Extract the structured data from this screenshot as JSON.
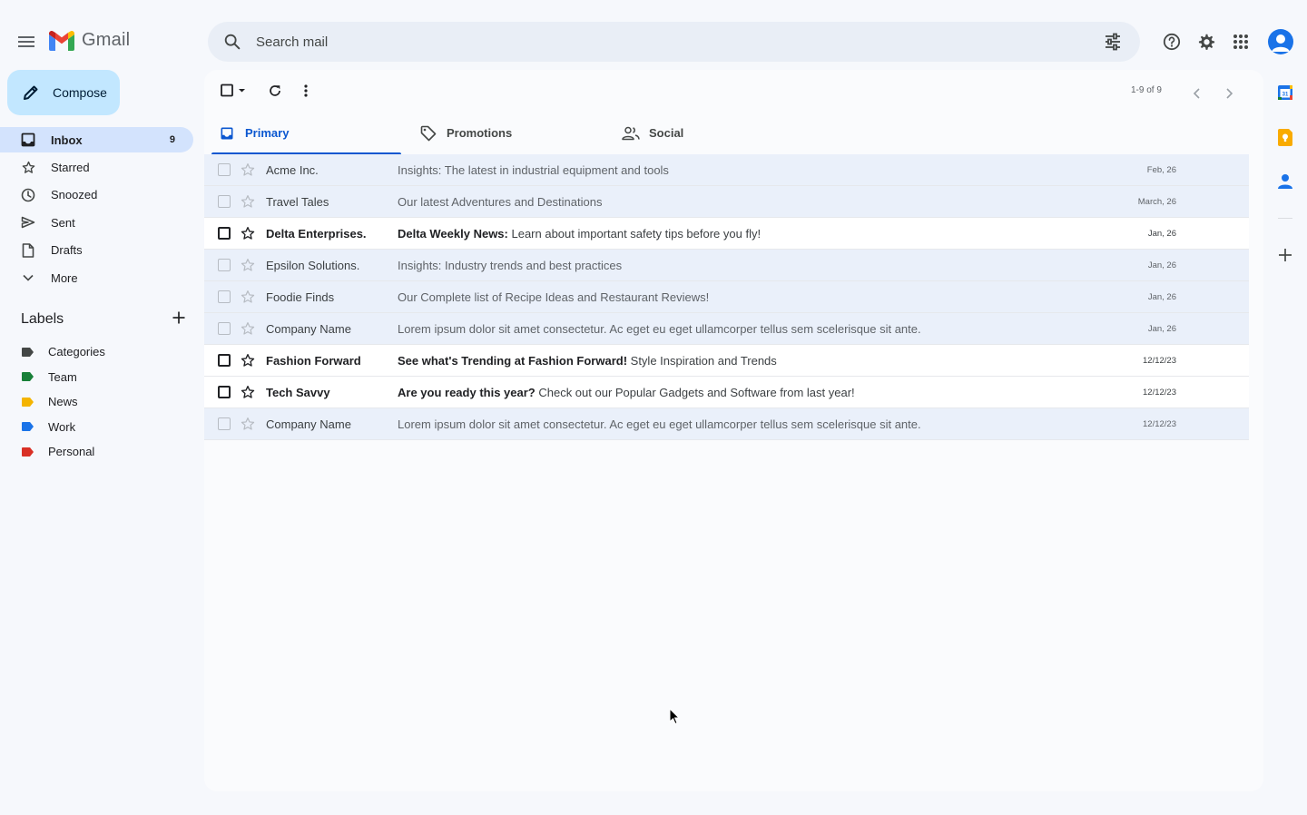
{
  "app": {
    "name": "Gmail"
  },
  "search": {
    "placeholder": "Search mail"
  },
  "compose": {
    "label": "Compose"
  },
  "nav": {
    "items": [
      {
        "label": "Inbox",
        "icon": "inbox-icon",
        "count": "9"
      },
      {
        "label": "Starred",
        "icon": "star-icon"
      },
      {
        "label": "Snoozed",
        "icon": "clock-icon"
      },
      {
        "label": "Sent",
        "icon": "send-icon"
      },
      {
        "label": "Drafts",
        "icon": "draft-icon"
      },
      {
        "label": "More",
        "icon": "chevron-down-icon"
      }
    ]
  },
  "labels": {
    "title": "Labels",
    "items": [
      {
        "label": "Categories",
        "color": "#444746"
      },
      {
        "label": "Team",
        "color": "#188038"
      },
      {
        "label": "News",
        "color": "#f4b400"
      },
      {
        "label": "Work",
        "color": "#1a73e8"
      },
      {
        "label": "Personal",
        "color": "#d93025"
      }
    ]
  },
  "toolbar": {
    "pager": "1-9 of 9"
  },
  "tabs": [
    {
      "label": "Primary",
      "icon": "inbox-icon"
    },
    {
      "label": "Promotions",
      "icon": "tag-icon"
    },
    {
      "label": "Social",
      "icon": "people-icon"
    }
  ],
  "emails": [
    {
      "sender": "Acme Inc.",
      "subject": "",
      "snippet": "Insights: The latest in industrial equipment and tools",
      "date": "Feb, 26",
      "unread": false
    },
    {
      "sender": "Travel Tales",
      "subject": "",
      "snippet": "Our latest Adventures and Destinations",
      "date": "March, 26",
      "unread": false
    },
    {
      "sender": "Delta Enterprises.",
      "subject": "Delta Weekly News:",
      "snippet": " Learn about important safety tips before you fly!",
      "date": "Jan, 26",
      "unread": true
    },
    {
      "sender": "Epsilon Solutions.",
      "subject": "",
      "snippet": "Insights: Industry trends and best practices",
      "date": "Jan, 26",
      "unread": false
    },
    {
      "sender": "Foodie Finds",
      "subject": "",
      "snippet": "Our Complete list of Recipe Ideas and Restaurant Reviews!",
      "date": "Jan, 26",
      "unread": false
    },
    {
      "sender": "Company Name",
      "subject": "",
      "snippet": "Lorem ipsum dolor sit amet consectetur. Ac eget eu eget ullamcorper tellus sem scelerisque sit ante.",
      "date": "Jan, 26",
      "unread": false
    },
    {
      "sender": "Fashion Forward",
      "subject": "See what's Trending at Fashion Forward!",
      "snippet": " Style Inspiration and Trends",
      "date": "12/12/23",
      "unread": true
    },
    {
      "sender": "Tech Savvy",
      "subject": "Are you ready this year?",
      "snippet": " Check out our Popular Gadgets and Software from last year!",
      "date": "12/12/23",
      "unread": true
    },
    {
      "sender": "Company Name",
      "subject": "",
      "snippet": "Lorem ipsum dolor sit amet consectetur. Ac eget eu eget ullamcorper tellus sem scelerisque sit ante.",
      "date": "12/12/23",
      "unread": false
    }
  ]
}
